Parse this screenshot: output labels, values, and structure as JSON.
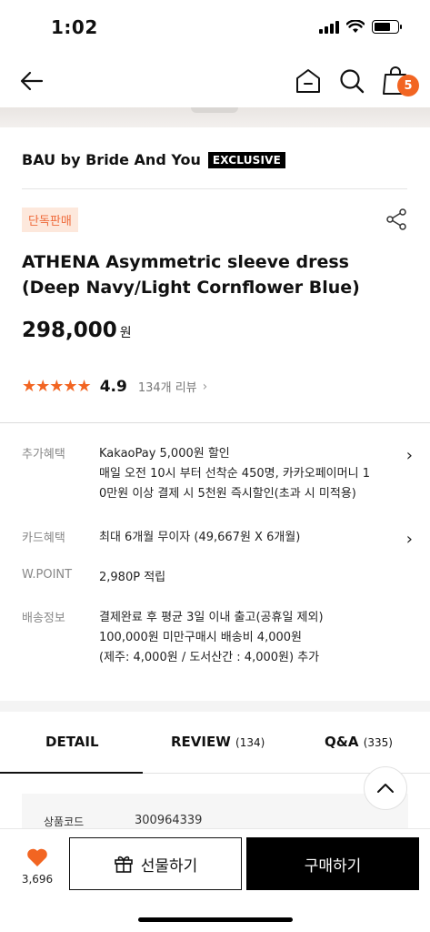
{
  "status_bar": {
    "time": "1:02"
  },
  "nav": {
    "cart_count": "5"
  },
  "brand": {
    "name": "BAU by Bride And You",
    "tag": "EXCLUSIVE"
  },
  "product": {
    "sale_badge": "단독판매",
    "title_line1": "ATHENA Asymmetric sleeve dress",
    "title_line2": "(Deep Navy/Light Cornflower Blue)",
    "price": "298,000",
    "price_unit": "원",
    "rating": "4.9",
    "rating_fraction": 0.98,
    "review_count": "134개 리뷰"
  },
  "info": {
    "benefit": {
      "label": "추가혜택",
      "line1": "KakaoPay 5,000원 할인",
      "line2": "매일 오전 10시 부터 선착순 450명, 카카오페이머니 1",
      "line3": "0만원 이상 결제 시 5천원 즉시할인(초과 시 미적용)"
    },
    "card": {
      "label": "카드혜택",
      "line1": "최대 6개월 무이자 (49,667원 X 6개월)"
    },
    "point": {
      "label": "W.POINT",
      "line1": "2,980P 적립"
    },
    "shipping": {
      "label": "배송정보",
      "line1": "결제완료 후 평균 3일 이내 출고(공휴일 제외)",
      "line2": "100,000원 미만구매시 배송비 4,000원",
      "line3": "(제주: 4,000원 / 도서산간 : 4,000원) 추가"
    }
  },
  "tabs": [
    {
      "label": "DETAIL",
      "count": ""
    },
    {
      "label": "REVIEW",
      "count": "(134)"
    },
    {
      "label": "Q&A",
      "count": "(335)"
    }
  ],
  "detail": {
    "code_label": "상품코드",
    "code_value": "300964339"
  },
  "bottom_bar": {
    "like_count": "3,696",
    "gift_label": "선물하기",
    "buy_label": "구매하기"
  },
  "colors": {
    "accent": "#f26522",
    "badge_bg": "#fde8dc",
    "dark": "#000000"
  }
}
